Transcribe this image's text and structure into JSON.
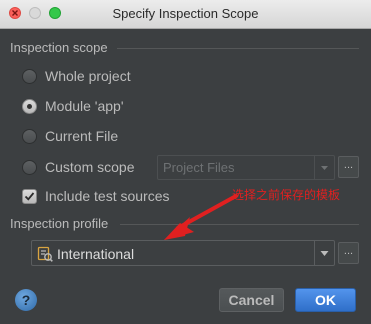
{
  "window": {
    "title": "Specify Inspection Scope"
  },
  "scope": {
    "label": "Inspection scope",
    "options": [
      {
        "label": "Whole project",
        "checked": false
      },
      {
        "label": "Module 'app'",
        "checked": true
      },
      {
        "label": "Current File",
        "checked": false
      },
      {
        "label": "Custom scope",
        "checked": false
      }
    ],
    "custom_combo_value": "Project Files",
    "browse_label": "...",
    "include_tests_label": "Include test sources",
    "include_tests_checked": true
  },
  "profile": {
    "label": "Inspection profile",
    "value": "International",
    "browse_label": "..."
  },
  "annotation": {
    "text": "选择之前保存的模板",
    "color": "#e02020"
  },
  "buttons": {
    "help_label": "?",
    "cancel_label": "Cancel",
    "ok_label": "OK"
  },
  "colors": {
    "accent": "#4a88c7",
    "background": "#3c3f41"
  }
}
